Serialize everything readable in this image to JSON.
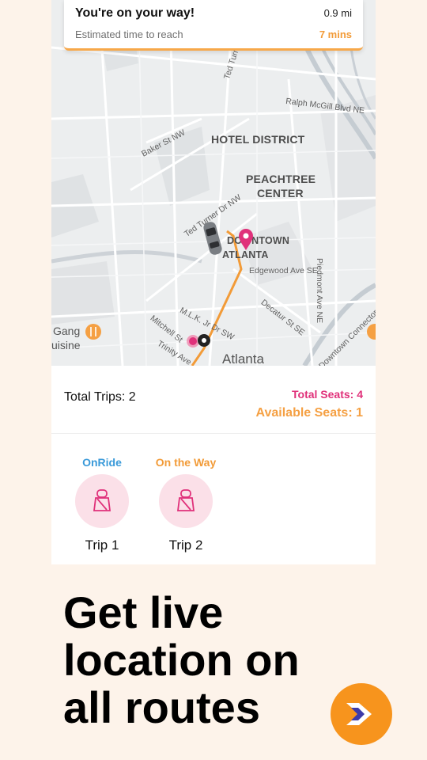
{
  "eta_banner": {
    "title": "You're on your way!",
    "distance": "0.9 mi",
    "subtitle": "Estimated time to reach",
    "time": "7 mins"
  },
  "map": {
    "districts": [
      "HOTEL DISTRICT",
      "PEACHTREE",
      "CENTER",
      "DOWNTOWN",
      "ATLANTA",
      "Atlanta"
    ],
    "streets": [
      "Ralph McGill Blvd NE",
      "Ted Turner Dr",
      "Baker St NW",
      "Ted Turner Dr NW",
      "Piedmont Ave NE",
      "Edgewood Ave SE",
      "Decatur St SE",
      "M.L.K. Jr Dr SW",
      "Mitchell St",
      "Trinity Ave",
      "Gang",
      "uisine",
      "Downtown Connector"
    ],
    "route_color": "#f29b38",
    "pin_color": "#e0317a"
  },
  "summary": {
    "total_trips": "Total Trips: 2",
    "total_seats": "Total Seats: 4",
    "available_seats": "Available Seats: 1"
  },
  "trips": [
    {
      "status": "OnRide",
      "status_color": "#3a9ad9",
      "label": "Trip 1",
      "icon": "seat-belt-icon"
    },
    {
      "status": "On the Way",
      "status_color": "#f29b38",
      "label": "Trip 2",
      "icon": "seat-belt-icon"
    }
  ],
  "headline": "Get live location on all routes",
  "next_button": {
    "icon": "arrow-right-icon",
    "color": "#f7941d"
  }
}
